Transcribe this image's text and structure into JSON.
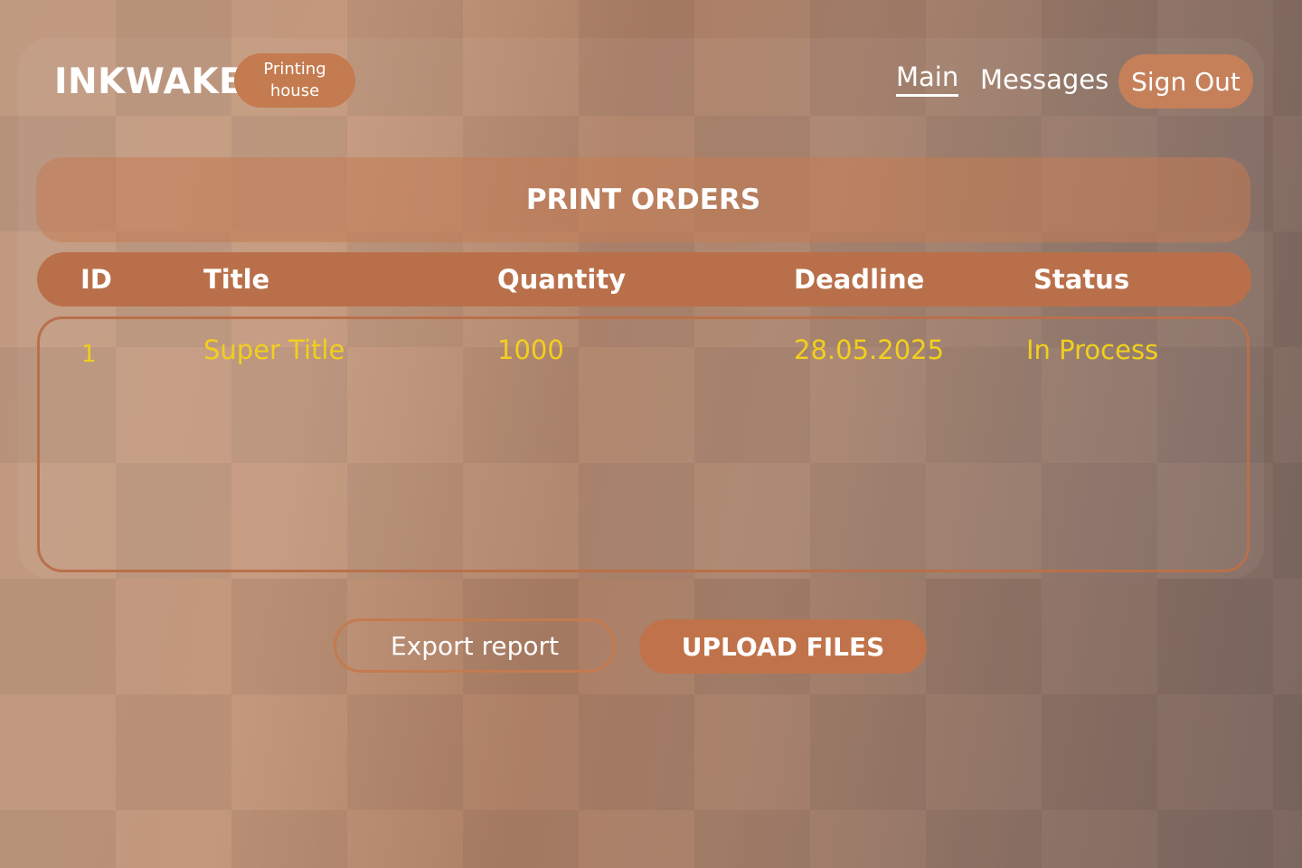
{
  "header": {
    "logo": "INKWAKE",
    "badge_line1": "Printing",
    "badge_line2": "house",
    "nav": {
      "main": "Main",
      "messages": "Messages"
    },
    "sign_out": "Sign Out"
  },
  "page": {
    "title": "PRINT ORDERS"
  },
  "table": {
    "columns": [
      "ID",
      "Title",
      "Quantity",
      "Deadline",
      "Status"
    ],
    "rows": [
      {
        "id": "1",
        "title": "Super Title",
        "quantity": "1000",
        "deadline": "28.05.2025",
        "status": "In Process"
      }
    ]
  },
  "actions": {
    "export": "Export report",
    "upload": "UPLOAD FILES"
  },
  "colors": {
    "accent": "#c47b4f",
    "header_bar": "#b9704a",
    "cell_text": "#f2cf1d",
    "text": "#ffffff"
  }
}
